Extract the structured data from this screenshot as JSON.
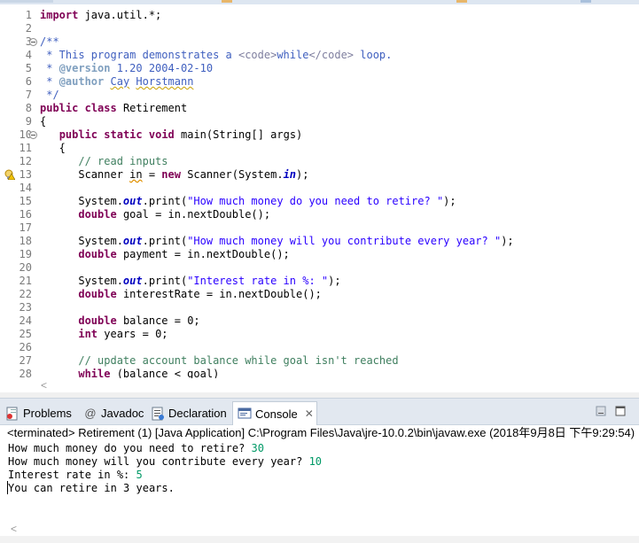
{
  "editor": {
    "line_numbers": [
      "1",
      "2",
      "3",
      "4",
      "5",
      "6",
      "7",
      "8",
      "9",
      "10",
      "11",
      "12",
      "13",
      "14",
      "15",
      "16",
      "17",
      "18",
      "19",
      "20",
      "21",
      "22",
      "23",
      "24",
      "25",
      "26",
      "27",
      "28"
    ],
    "code": {
      "l1_kw": "import",
      "l1_rest": " java.util.*;",
      "l3": "/**",
      "l4_a": " * This program demonstrates a ",
      "l4_t1": "<code>",
      "l4_b": "while",
      "l4_t2": "</code>",
      "l4_c": " loop.",
      "l5_a": " * ",
      "l5_tag": "@version",
      "l5_b": " 1.20 2004-02-10",
      "l6_a": " * ",
      "l6_tag": "@author",
      "l6_b": " ",
      "l6_c": "Cay",
      "l6_d": " ",
      "l6_e": "Horstmann",
      "l7": " */",
      "l8_kw1": "public",
      "l8_sp": " ",
      "l8_kw2": "class",
      "l8_rest": " Retirement",
      "l9": "{",
      "l10_ind": "   ",
      "l10_kw1": "public",
      "l10_kw2": "static",
      "l10_kw3": "void",
      "l10_rest": " main(String[] args)",
      "l11": "   {",
      "l12": "      // read inputs",
      "l13_a": "      Scanner ",
      "l13_b": "in",
      "l13_c": " = ",
      "l13_kw": "new",
      "l13_d": " Scanner(System.",
      "l13_st": "in",
      "l13_e": ");",
      "l15_a": "      System.",
      "l15_st": "out",
      "l15_b": ".print(",
      "l15_str": "\"How much money do you need to retire? \"",
      "l15_c": ");",
      "l16_ind": "      ",
      "l16_kw": "double",
      "l16_rest": " goal = in.nextDouble();",
      "l18_a": "      System.",
      "l18_st": "out",
      "l18_b": ".print(",
      "l18_str": "\"How much money will you contribute every year? \"",
      "l18_c": ");",
      "l19_ind": "      ",
      "l19_kw": "double",
      "l19_rest": " payment = in.nextDouble();",
      "l21_a": "      System.",
      "l21_st": "out",
      "l21_b": ".print(",
      "l21_str": "\"Interest rate in %: \"",
      "l21_c": ");",
      "l22_ind": "      ",
      "l22_kw": "double",
      "l22_rest": " interestRate = in.nextDouble();",
      "l24_ind": "      ",
      "l24_kw": "double",
      "l24_rest": " balance = 0;",
      "l25_ind": "      ",
      "l25_kw": "int",
      "l25_rest": " years = 0;",
      "l27": "      // update account balance while goal isn't reached",
      "l28_ind": "      ",
      "l28_kw": "while",
      "l28_rest": " (balance < goal)"
    }
  },
  "views": {
    "tabs": [
      {
        "label": "Problems",
        "icon": "problems-icon"
      },
      {
        "label": "Javadoc",
        "icon": "at-icon"
      },
      {
        "label": "Declaration",
        "icon": "declaration-icon"
      },
      {
        "label": "Console",
        "icon": "console-icon",
        "active": true
      }
    ],
    "close_glyph": "✕"
  },
  "console": {
    "status": "<terminated> Retirement (1) [Java Application] C:\\Program Files\\Java\\jre-10.0.2\\bin\\javaw.exe (2018年9月8日 下午9:29:54)",
    "lines": [
      {
        "prompt": "How much money do you need to retire? ",
        "input": "30"
      },
      {
        "prompt": "How much money will you contribute every year? ",
        "input": "10"
      },
      {
        "prompt": "Interest rate in %: ",
        "input": "5"
      },
      {
        "prompt": "You can retire in 3 years.",
        "input": ""
      }
    ]
  },
  "colors": {
    "keyword": "#7f0055",
    "comment": "#3f7f5f",
    "javadoc": "#3f5fbf",
    "string": "#2a00ff",
    "static_field": "#0000c0",
    "console_input": "#009966",
    "tabbar_bg": "#e2e8f0"
  }
}
